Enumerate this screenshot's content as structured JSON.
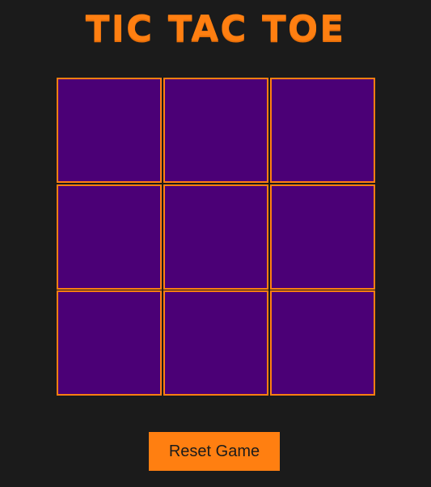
{
  "title": "TIC TAC TOE",
  "board": {
    "cells": [
      "",
      "",
      "",
      "",
      "",
      "",
      "",
      "",
      ""
    ]
  },
  "controls": {
    "reset_label": "Reset Game"
  },
  "colors": {
    "background": "#1b1b1b",
    "accent": "#ff7f11",
    "cell_fill": "#4b0076"
  }
}
